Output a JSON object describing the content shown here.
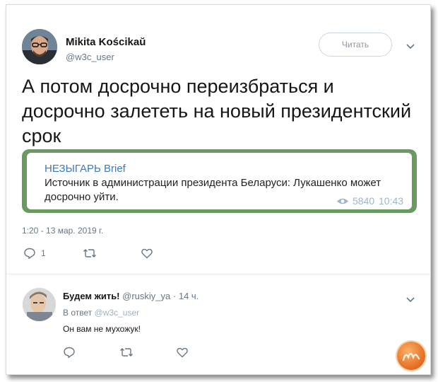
{
  "tweet": {
    "author_name": "Mikita Kościkaŭ",
    "author_handle": "@w3c_user",
    "follow_label": "Читать",
    "text": "А потом досрочно переизбраться и досрочно залететь на новый президентский срок",
    "date": "1:20 - 13 мар. 2019 г.",
    "reply_count": "1"
  },
  "card": {
    "channel": "НЕЗЫГАРЬ Brief",
    "text": "Источник в администрации президента Беларуси: Лукашенко может досрочно уйти.",
    "views": "5840",
    "time": "10:43"
  },
  "reply": {
    "name": "Будем жить!",
    "handle": "@ruskiy_ya",
    "separator": "·",
    "age": "14 ч.",
    "in_reply_prefix": "В ответ",
    "in_reply_handle": "@w3c_user",
    "text": "Он вам не мухожук!"
  },
  "colors": {
    "card_border": "#6a9a62",
    "channel_link": "#3a7ac4",
    "secondary_text": "#657786",
    "icon": "#657786"
  },
  "icons": [
    "chevron-down-icon",
    "eye-icon",
    "reply-icon",
    "retweet-icon",
    "like-icon",
    "site-logo"
  ]
}
